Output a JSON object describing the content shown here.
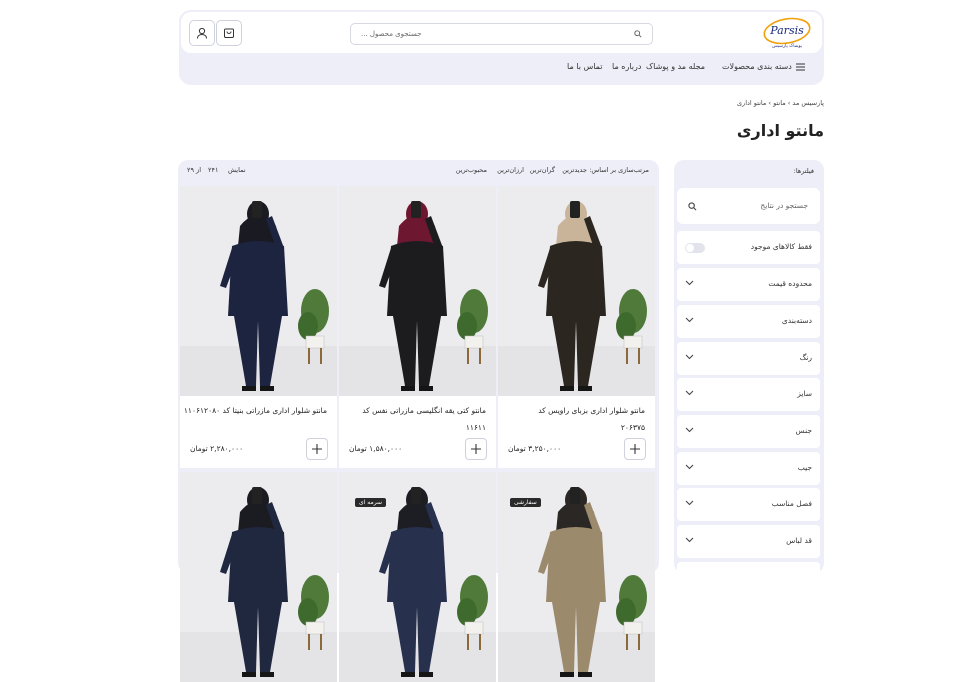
{
  "header": {
    "search_placeholder": "جستجوی محصول ...",
    "logo_text": "Parsis",
    "logo_sub": "پوشاک پارسیس"
  },
  "nav": {
    "categories": "دسته بندی محصولات",
    "magazine": "مجله مد و پوشاک",
    "about": "درباره ما",
    "contact": "تماس با ما"
  },
  "breadcrumb": "پارسیس مد › مانتو › مانتو اداری",
  "page_title": "مانتو اداری",
  "sidebar": {
    "label": "فیلترها:",
    "search_placeholder": "جستجو در نتایج",
    "only_available": "فقط کالاهای موجود",
    "filters": [
      "محدوده قیمت",
      "دسته‌بندی",
      "رنگ",
      "سایز",
      "جنس",
      "جیب",
      "فصل مناسب",
      "قد لباس"
    ]
  },
  "sortbar": {
    "label": "مرتب‌سازی بر اساس:",
    "options": [
      "جدیدترین",
      "گران‌ترین",
      "ارزان‌ترین",
      "محبوب‌ترین"
    ],
    "show_label": "نمایش",
    "count": "۲۴۱",
    "of": "از ۲۹"
  },
  "products": [
    {
      "name": "مانتو شلوار اداری بزبای راویس کد",
      "code": "۲۰۶۳۷۵",
      "price": "۳,۲۵۰,۰۰۰ تومان",
      "outfit": "#2b2620",
      "scarf": "#c9b49a"
    },
    {
      "name": "مانتو کتی یقه انگلیسی مازراتی نفس کد",
      "code": "۱۱۶۱۱",
      "price": "۱,۵۸۰,۰۰۰ تومان",
      "outfit": "#1c1c1f",
      "scarf": "#6d1730"
    },
    {
      "name": "مانتو شلوار اداری مازراتی بنیتا کد ۱۱۰۶۱۲۰۸۰",
      "code": "",
      "price": "۲,۲۸۰,۰۰۰ تومان",
      "outfit": "#1d2440",
      "scarf": "#1a1a22"
    }
  ],
  "products_row2": [
    {
      "tag": "سفارشی",
      "outfit": "#9c8a6d",
      "scarf": "#2a2725"
    },
    {
      "tag": "سرمه ای",
      "outfit": "#27304d",
      "scarf": "#1d1d24"
    },
    {
      "tag": "",
      "outfit": "#20283f",
      "scarf": "#1b1b22"
    }
  ]
}
